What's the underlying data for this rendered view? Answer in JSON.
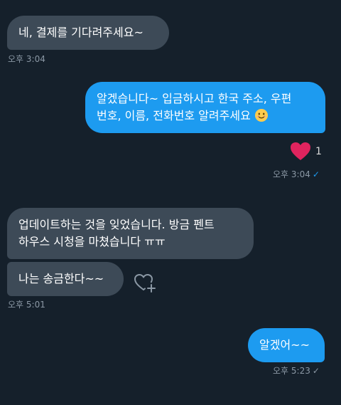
{
  "messages": {
    "m1": {
      "text": "네, 결제를 기다려주세요~",
      "time": "오후 3:04"
    },
    "m2": {
      "line1": "알겠습니다~ 입금하시고 한국 주소, 우편",
      "line2": "번호, 이름, 전화번호 알려주세요",
      "emoji": "smiling-face-emoji",
      "time": "오후 3:04",
      "reaction_count": "1",
      "reaction_icon": "heart-icon"
    },
    "m3": {
      "line1": "업데이트하는 것을 잊었습니다. 방금 펜트",
      "line2": "하우스 시청을 마쳤습니다 ㅠㅠ"
    },
    "m4": {
      "text": "나는 송금한다~~",
      "time": "오후 5:01"
    },
    "m5": {
      "text": "알겠어~~",
      "time": "오후 5:23"
    }
  },
  "colors": {
    "background": "#15202b",
    "incoming_bubble": "#3d4a57",
    "outgoing_bubble": "#1d9bf0",
    "heart": "#e0245e",
    "timestamp": "#8b98a5"
  }
}
